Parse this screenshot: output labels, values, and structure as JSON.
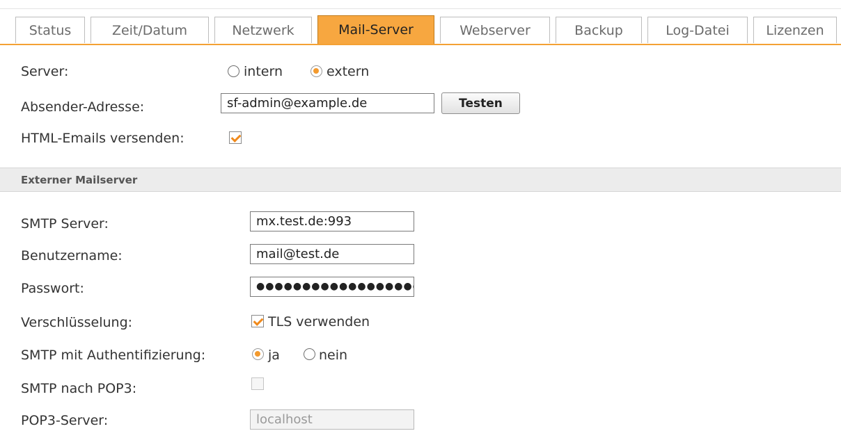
{
  "tabs": [
    {
      "label": "Status",
      "active": false
    },
    {
      "label": "Zeit/Datum",
      "active": false
    },
    {
      "label": "Netzwerk",
      "active": false
    },
    {
      "label": "Mail-Server",
      "active": true
    },
    {
      "label": "Webserver",
      "active": false
    },
    {
      "label": "Backup",
      "active": false
    },
    {
      "label": "Log-Datei",
      "active": false
    },
    {
      "label": "Lizenzen",
      "active": false
    }
  ],
  "general": {
    "server_label": "Server:",
    "server_options": [
      {
        "label": "intern",
        "checked": false
      },
      {
        "label": "extern",
        "checked": true
      }
    ],
    "sender_label": "Absender-Adresse:",
    "sender_value": "sf-admin@example.de",
    "test_button": "Testen",
    "html_label": "HTML-Emails versenden:",
    "html_checked": true
  },
  "external": {
    "section_title": "Externer Mailserver",
    "smtp_label": "SMTP Server:",
    "smtp_value": "mx.test.de:993",
    "user_label": "Benutzername:",
    "user_value": "mail@test.de",
    "password_label": "Passwort:",
    "password_value": "●●●●●●●●●●●●●●●●●●●●",
    "encryption_label": "Verschlüsselung:",
    "tls_label": "TLS verwenden",
    "tls_checked": true,
    "auth_label": "SMTP mit Authentifizierung:",
    "auth_options": [
      {
        "label": "ja",
        "checked": true
      },
      {
        "label": "nein",
        "checked": false
      }
    ],
    "pop3_label": "SMTP nach POP3:",
    "pop3_checked": false,
    "pop3_server_label": "POP3-Server:",
    "pop3_server_value": "localhost"
  },
  "colors": {
    "accent": "#f7a740",
    "check": "#f08a1c",
    "section_bg": "#ececec"
  }
}
